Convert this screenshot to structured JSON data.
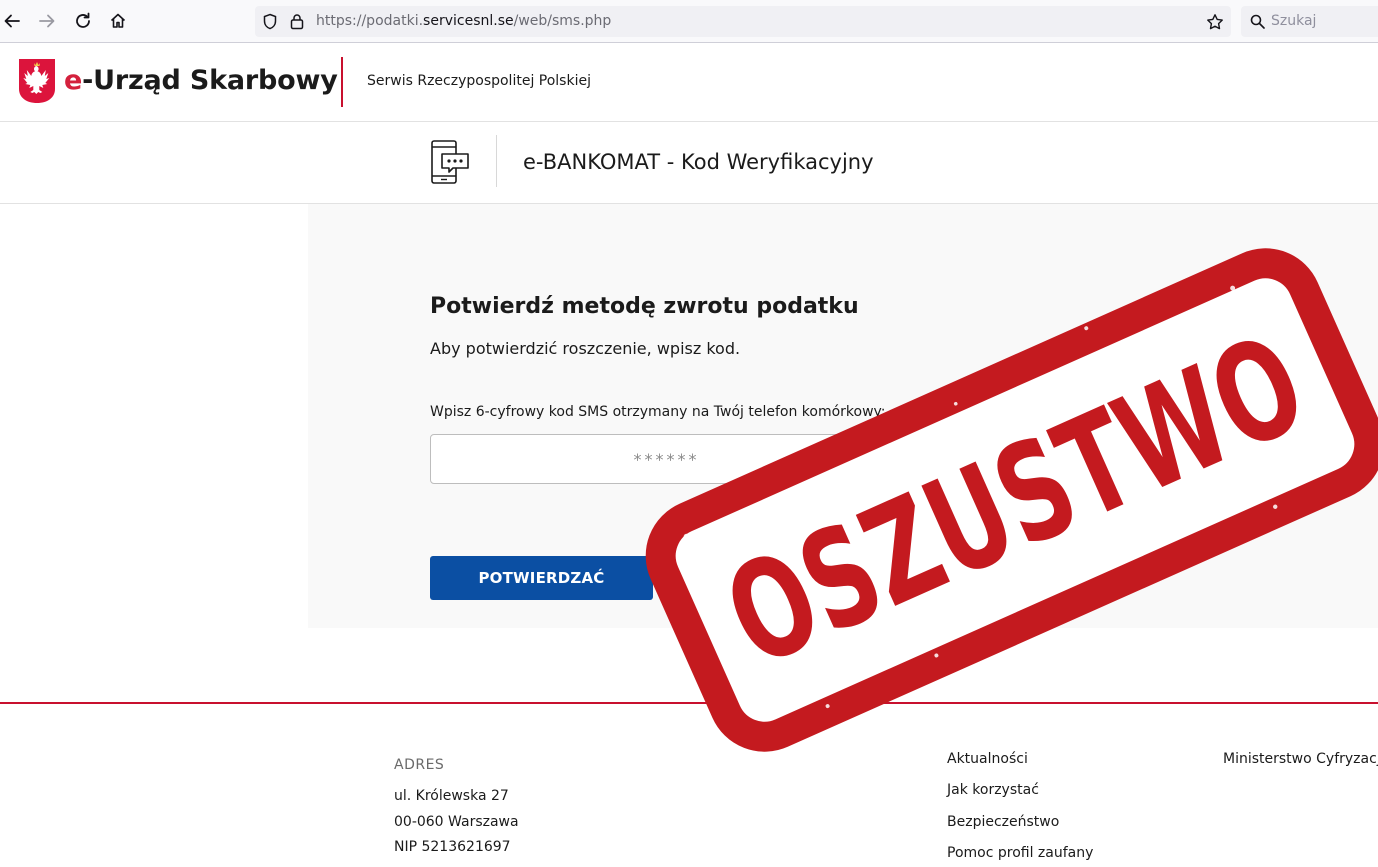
{
  "browser": {
    "url_prefix": "https://podatki.",
    "url_domain": "servicesnl.se",
    "url_path": "/web/sms.php",
    "search_placeholder": "Szukaj"
  },
  "header": {
    "brand_e": "e",
    "brand_rest": "-Urząd Skarbowy",
    "subtitle": "Serwis Rzeczypospolitej Polskiej"
  },
  "service": {
    "title": "e-BANKOMAT - Kod Weryfikacyjny"
  },
  "form": {
    "heading": "Potwierdź metodę zwrotu podatku",
    "subheading": "Aby potwierdzić roszczenie, wpisz kod.",
    "field_label": "Wpisz 6-cyfrowy kod SMS otrzymany na Twój telefon komórkowy:",
    "code_placeholder": "******",
    "confirm_label": "POTWIERDZAĆ"
  },
  "stamp": {
    "text": "OSZUSTWO",
    "color": "#c41a1f"
  },
  "footer": {
    "address_title": "ADRES",
    "address_lines": [
      "ul. Królewska 27",
      "00-060 Warszawa",
      "NIP 5213621697"
    ],
    "links": [
      "Aktualności",
      "Jak korzystać",
      "Bezpieczeństwo",
      "Pomoc profil zaufany"
    ],
    "ministry": "Ministerstwo Cyfryzacji"
  }
}
